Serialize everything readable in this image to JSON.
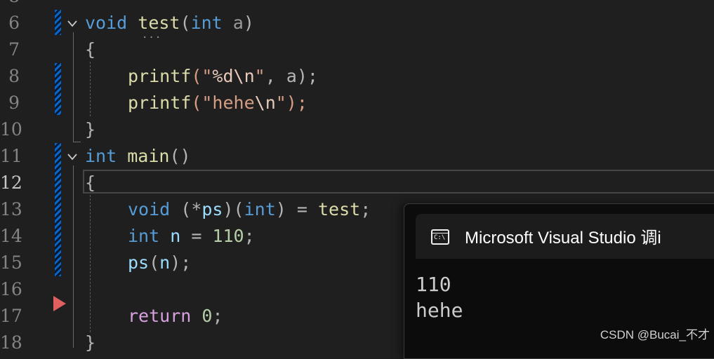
{
  "editor": {
    "lines": [
      {
        "num": "8"
      },
      {
        "num": "6",
        "code": "void test(int a)"
      },
      {
        "num": "7",
        "code": "{"
      },
      {
        "num": "8",
        "code": "printf(\"%d\\n\", a);"
      },
      {
        "num": "9",
        "code": "printf(\"hehe\\n\");"
      },
      {
        "num": "10",
        "code": "}"
      },
      {
        "num": "11",
        "code": "int main()"
      },
      {
        "num": "12",
        "code": "{"
      },
      {
        "num": "13",
        "code": "void (*ps)(int) = test;"
      },
      {
        "num": "14",
        "code": "int n = 110;"
      },
      {
        "num": "15",
        "code": "ps(n);"
      },
      {
        "num": "16",
        "code": ""
      },
      {
        "num": "17",
        "code": "return 0;"
      },
      {
        "num": "18",
        "code": "}"
      }
    ],
    "tokens": {
      "l6_void": "void",
      "l6_test": "test",
      "l6_open": "(",
      "l6_int": "int",
      "l6_a": " a",
      "l6_close": ")",
      "l7_brace": "{",
      "l8_printf": "printf",
      "l8_open": "(\"",
      "l8_fmt": "%d",
      "l8_esc": "\\n",
      "l8_quote": "\"",
      "l8_rest": ", a);",
      "l9_printf": "printf",
      "l9_open": "(\"",
      "l9_str": "hehe",
      "l9_esc": "\\n",
      "l9_rest": "\");",
      "l10_brace": "}",
      "l11_int": "int",
      "l11_main": "main",
      "l11_parens": "()",
      "l12_brace": "{",
      "l13_void": "void",
      "l13_p1": " (*",
      "l13_ps": "ps",
      "l13_p2": ")(",
      "l13_int": "int",
      "l13_p3": ") = ",
      "l13_test": "test",
      "l13_semi": ";",
      "l14_int": "int",
      "l14_n": "n",
      "l14_eq": " = ",
      "l14_num": "110",
      "l14_semi": ";",
      "l15_ps": "ps",
      "l15_open": "(",
      "l15_n": "n",
      "l15_close": ");",
      "l17_return": "return",
      "l17_num": "0",
      "l17_semi": ";",
      "l18_brace": "}"
    },
    "current_line": "12"
  },
  "console": {
    "title": "Microsoft Visual Studio 调i",
    "icon_text": "C:\\",
    "output": [
      "110",
      "hehe"
    ]
  },
  "watermark": "CSDN @Bucai_不才",
  "icons": [
    "fold-chevron-icon",
    "breakpoint-arrow-icon",
    "console-window-icon"
  ],
  "colors": {
    "background": "#1f1f1f",
    "keyword": "#569cd6",
    "function": "#dcdcaa",
    "string": "#d69d85",
    "number": "#b5cea8",
    "change_bar": "#0a64c8"
  }
}
